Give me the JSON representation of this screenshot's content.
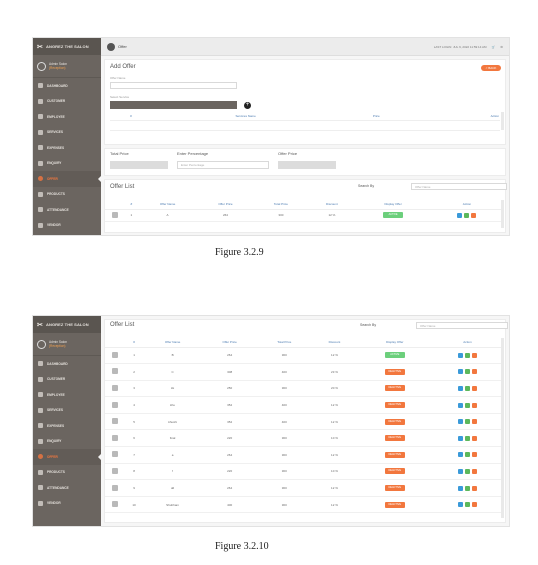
{
  "figure1": {
    "brand": "ANGREZ THE SALON",
    "user": {
      "name": "Admin Salon",
      "role": "(Reception)"
    },
    "nav": [
      "DASHBOARD",
      "CUSTOMER",
      "EMPLOYEE",
      "SERVICES",
      "EXPENSES",
      "ENQUIRY",
      "OFFER",
      "PRODUCTS",
      "ATTENDANCE",
      "VENDOR"
    ],
    "topbar_title": "Offer",
    "last_login": "LAST LOGIN: JUL 9, 2022 11:59:14 AM",
    "add_offer_title": "Add Offer",
    "back_label": "< BACK",
    "offer_name_label": "Offer Name",
    "select_service_label": "Select Service",
    "services_table": {
      "headers": [
        "#",
        "Services Name",
        "Price",
        "Action"
      ]
    },
    "total_price_label": "Total Price",
    "enter_percentage_label": "Enter Percentage",
    "percentage_placeholder": "Enter Percentage",
    "offer_price_label": "Offer Price",
    "offer_list_title": "Offer List",
    "search_by_label": "Search By",
    "search_placeholder": "Offer Name",
    "list_headers": [
      "#",
      "Offer Name",
      "Offer Price",
      "Total Price",
      "Discount",
      "Display Offer",
      "Action"
    ],
    "rows": [
      {
        "n": "1",
        "name": "A",
        "offer": "264",
        "total": "300",
        "disc": "12 %",
        "status": "ACTIVE"
      }
    ]
  },
  "caption1": "Figure 3.2.9",
  "figure2": {
    "brand": "ANGREZ THE SALON",
    "user": {
      "name": "Admin Salon",
      "role": "(Reception)"
    },
    "nav": [
      "DASHBOARD",
      "CUSTOMER",
      "EMPLOYEE",
      "SERVICES",
      "EXPENSES",
      "ENQUIRY",
      "OFFER",
      "PRODUCTS",
      "ATTENDANCE",
      "VENDOR"
    ],
    "offer_list_title": "Offer List",
    "search_by_label": "Search By",
    "search_placeholder": "Offer Name",
    "list_headers": [
      "#",
      "Offer Name",
      "Offer Price",
      "Total Price",
      "Discount",
      "Display Offer",
      "Action"
    ],
    "rows": [
      {
        "n": "1",
        "name": "B",
        "offer": "264",
        "total": "300",
        "disc": "12 %",
        "status": "ACTIVE"
      },
      {
        "n": "2",
        "name": "C",
        "offer": "308",
        "total": "400",
        "disc": "23 %",
        "status": "DEACTIVE"
      },
      {
        "n": "3",
        "name": "kk",
        "offer": "250",
        "total": "300",
        "disc": "20 %",
        "status": "DEACTIVE"
      },
      {
        "n": "4",
        "name": "khu",
        "offer": "352",
        "total": "400",
        "disc": "12 %",
        "status": "DEACTIVE"
      },
      {
        "n": "5",
        "name": "khushi",
        "offer": "352",
        "total": "400",
        "disc": "12 %",
        "status": "DEACTIVE"
      },
      {
        "n": "6",
        "name": "final",
        "offer": "220",
        "total": "300",
        "disc": "10 %",
        "status": "DEACTIVE"
      },
      {
        "n": "7",
        "name": "a",
        "offer": "264",
        "total": "300",
        "disc": "12 %",
        "status": "DEACTIVE"
      },
      {
        "n": "8",
        "name": "f",
        "offer": "220",
        "total": "300",
        "disc": "10 %",
        "status": "DEACTIVE"
      },
      {
        "n": "9",
        "name": "dd",
        "offer": "264",
        "total": "300",
        "disc": "12 %",
        "status": "DEACTIVE"
      },
      {
        "n": "10",
        "name": "Shubham",
        "offer": "400",
        "total": "300",
        "disc": "12 %",
        "status": "DEACTIVE"
      }
    ]
  },
  "caption2": "Figure 3.2.10",
  "colors": {
    "sidebar": "#6b6560",
    "accent": "#f2773e",
    "active": "#6ccf7c",
    "link": "#4a7ab0"
  }
}
